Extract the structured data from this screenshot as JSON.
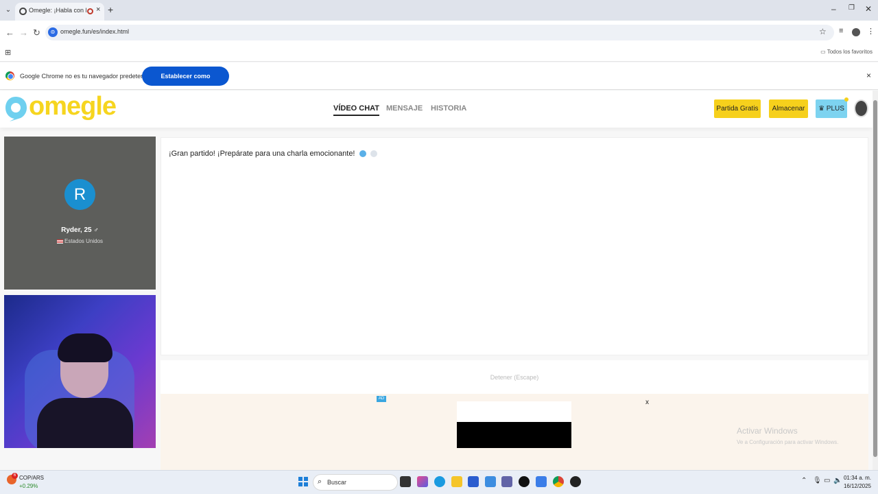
{
  "browser": {
    "tab_title": "Omegle: ¡Habla con Descon",
    "tab_close": "×",
    "new_tab": "+",
    "url": "omegle.fun/es/index.html",
    "bookmarks_all": "Todos los favoritos",
    "window_controls": [
      "–",
      "❐",
      "✕"
    ]
  },
  "infobar": {
    "message": "Google Chrome no es tu navegador predeterminado",
    "button": "Establecer como predeterminado",
    "close": "×"
  },
  "site": {
    "logo_text": "omegle",
    "nav": [
      {
        "label": "VÍDEO CHAT",
        "active": true
      },
      {
        "label": "MENSAJE",
        "active": false
      },
      {
        "label": "HISTORIA",
        "active": false
      }
    ],
    "buttons": {
      "free_match": "Partida Gratis",
      "store": "Almacenar",
      "plus": "♛ PLUS"
    }
  },
  "partner": {
    "initial": "R",
    "name": "Ryder, 25 ♂",
    "country": "Estados Unidos"
  },
  "chat": {
    "message": "¡Gran partido! ¡Prepárate para una charla emocionante!"
  },
  "stop": {
    "label": "Detener (Escape)"
  },
  "ad": {
    "tag": "AD",
    "close": "x"
  },
  "watermark": {
    "line1": "Activar Windows",
    "line2": "Ve a Configuración para activar Windows."
  },
  "taskbar": {
    "ticker": "COP/ARS",
    "change": "+0.29%",
    "badge": "6",
    "search": "Buscar",
    "time": "01:34 a. m.",
    "date": "16/12/2025"
  },
  "colors": {
    "brand_yellow": "#f6d01c",
    "plus_blue": "#7dd3f0",
    "partner_avatar": "#1a8fd0",
    "chrome_blue": "#0b57d0"
  }
}
